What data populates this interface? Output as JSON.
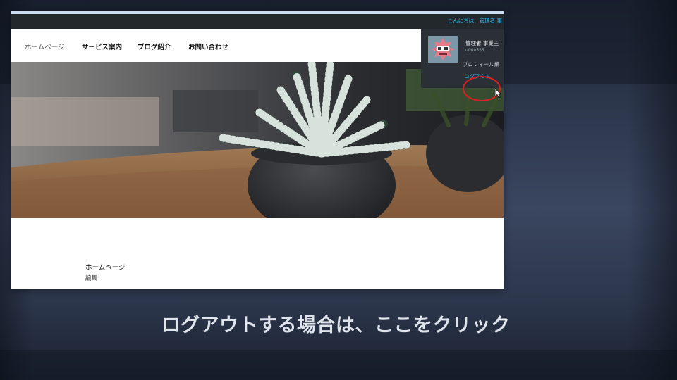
{
  "admin_bar": {
    "greeting": "こんにちは、管理者 事"
  },
  "nav": {
    "items": [
      {
        "label": "ホームページ"
      },
      {
        "label": "サービス案内"
      },
      {
        "label": "ブログ紹介"
      },
      {
        "label": "お問い合わせ"
      }
    ]
  },
  "user_menu": {
    "display_name": "管理者 事業主",
    "user_id": "u000555",
    "profile_label": "プロフィール編",
    "logout_label": "ログアウト"
  },
  "content": {
    "page_heading": "ホームページ",
    "edit_link": "編集"
  },
  "caption": "ログアウトする場合は、ここをクリック",
  "colors": {
    "admin_bar_bg": "#23282d",
    "link_blue": "#35b8e6",
    "highlight_ring": "#e02020"
  },
  "icons": {
    "avatar": "avatar-image",
    "cursor": "mouse-pointer-icon"
  }
}
